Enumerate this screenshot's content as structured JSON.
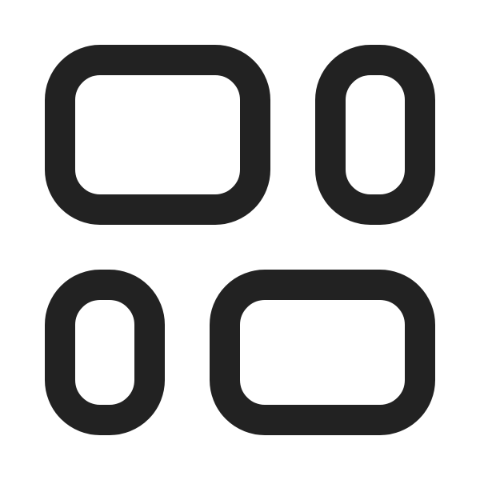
{
  "icon": {
    "name": "board-layout-icon",
    "stroke_color": "#222222",
    "background_color": "#ffffff"
  }
}
